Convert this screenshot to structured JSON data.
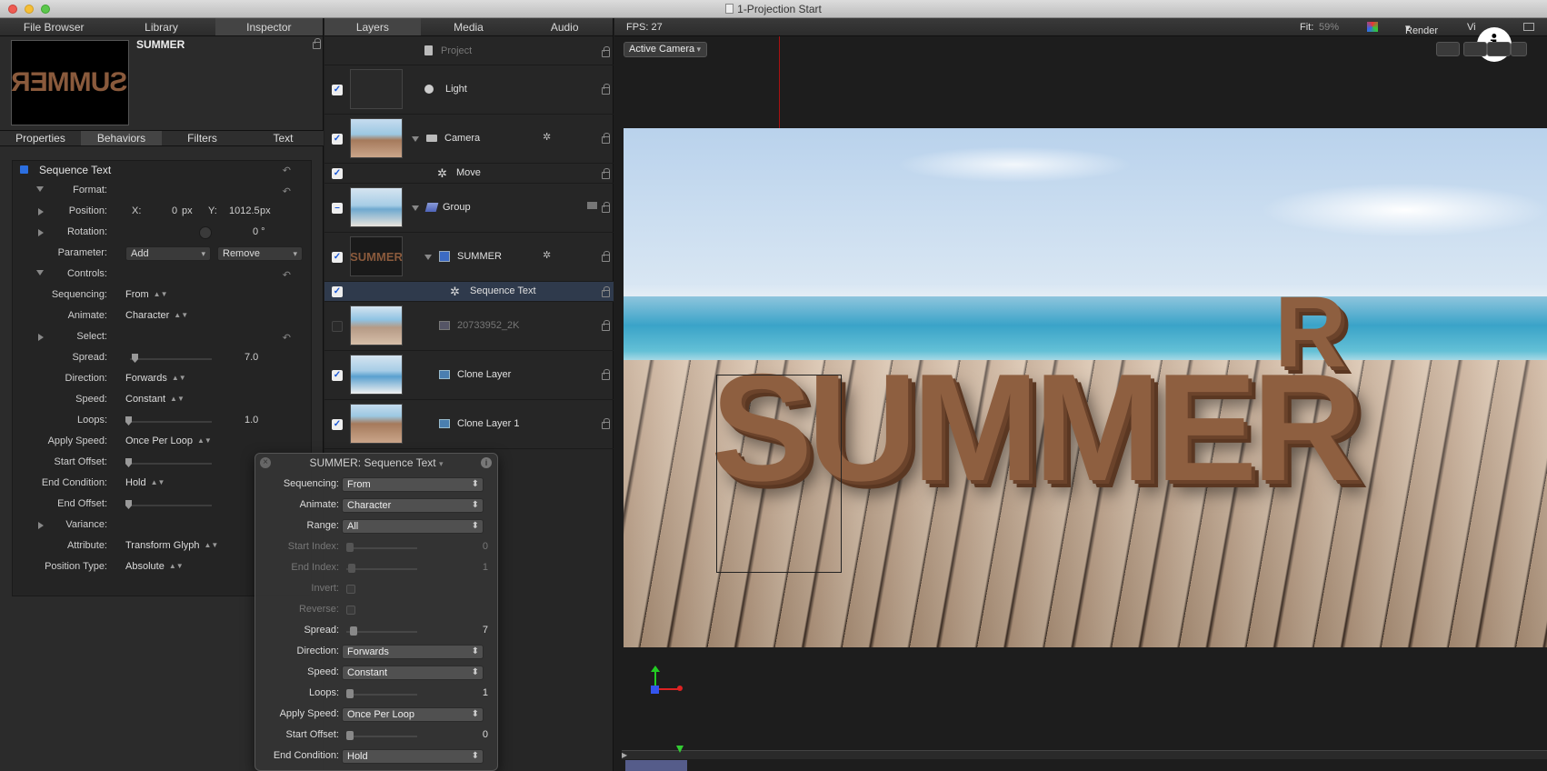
{
  "window": {
    "title": "1-Projection Start"
  },
  "inspector_tabs": [
    "File Browser",
    "Library",
    "Inspector"
  ],
  "inspector": {
    "name": "SUMMER",
    "thumb_text": "SUMMER",
    "subtabs": [
      "Properties",
      "Behaviors",
      "Filters",
      "Text"
    ],
    "behavior_title": "Sequence Text",
    "rows": {
      "format": "Format:",
      "position": "Position:",
      "pos_x_label": "X:",
      "pos_x": "0",
      "pos_x_unit": "px",
      "pos_y_label": "Y:",
      "pos_y": "1012.5",
      "pos_y_unit": "px",
      "rotation": "Rotation:",
      "rotation_val": "0 °",
      "parameter": "Parameter:",
      "param_add": "Add",
      "param_remove": "Remove",
      "controls": "Controls:",
      "sequencing": "Sequencing:",
      "sequencing_val": "From",
      "animate": "Animate:",
      "animate_val": "Character",
      "select": "Select:",
      "spread": "Spread:",
      "spread_val": "7.0",
      "direction": "Direction:",
      "direction_val": "Forwards",
      "speed": "Speed:",
      "speed_val": "Constant",
      "loops": "Loops:",
      "loops_val": "1.0",
      "apply_speed": "Apply Speed:",
      "apply_speed_val": "Once Per Loop",
      "start_offset": "Start Offset:",
      "end_condition": "End Condition:",
      "end_condition_val": "Hold",
      "end_offset": "End Offset:",
      "variance": "Variance:",
      "attribute": "Attribute:",
      "attribute_val": "Transform Glyph",
      "position_type": "Position Type:",
      "position_type_val": "Absolute"
    }
  },
  "layers_tabs": [
    "Layers",
    "Media",
    "Audio"
  ],
  "layers": [
    {
      "name": "Project"
    },
    {
      "name": "Light"
    },
    {
      "name": "Camera"
    },
    {
      "name": "Move"
    },
    {
      "name": "Group"
    },
    {
      "name": "SUMMER"
    },
    {
      "name": "Sequence Text"
    },
    {
      "name": "20733952_2K"
    },
    {
      "name": "Clone Layer"
    },
    {
      "name": "Clone Layer 1"
    }
  ],
  "canvas": {
    "fps": "FPS: 27",
    "fit_label": "Fit:",
    "fit_val": "59%",
    "render": "Render",
    "view": "Vi",
    "camera_select": "Active Camera",
    "scene_text": "SUMMER",
    "scene_text_r": "R"
  },
  "hud": {
    "title": "SUMMER: Sequence Text",
    "sequencing": "Sequencing:",
    "sequencing_val": "From",
    "animate": "Animate:",
    "animate_val": "Character",
    "range": "Range:",
    "range_val": "All",
    "start_index": "Start Index:",
    "start_index_val": "0",
    "end_index": "End Index:",
    "end_index_val": "1",
    "invert": "Invert:",
    "reverse": "Reverse:",
    "spread": "Spread:",
    "spread_val": "7",
    "direction": "Direction:",
    "direction_val": "Forwards",
    "speed": "Speed:",
    "speed_val": "Constant",
    "loops": "Loops:",
    "loops_val": "1",
    "apply_speed": "Apply Speed:",
    "apply_speed_val": "Once Per Loop",
    "start_offset": "Start Offset:",
    "start_offset_val": "0",
    "end_condition": "End Condition:",
    "end_condition_val": "Hold"
  }
}
